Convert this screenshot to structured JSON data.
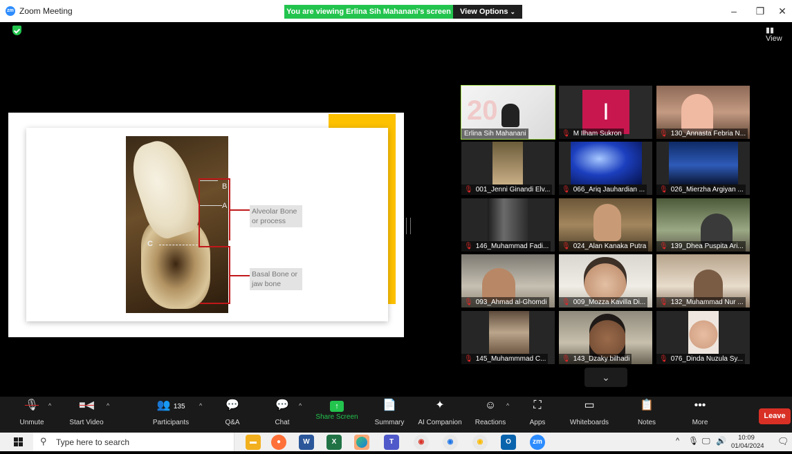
{
  "window": {
    "app_title": "Zoom Meeting",
    "logo_text": "zm",
    "viewing_banner": "You are viewing Erlina Sih Mahanani's screen",
    "view_options_label": "View Options",
    "view_button_label": "View",
    "minimize_glyph": "–",
    "restore_glyph": "❐",
    "close_glyph": "✕"
  },
  "slide": {
    "label_b": "B",
    "label_a": "A",
    "label_c": "C",
    "alveolar_label": "Alveolar Bone or process",
    "basal_label": "Basal Bone or jaw bone",
    "brand_color": "#fdc100"
  },
  "gallery": {
    "participants": [
      {
        "name": "Erlina Sih Mahanani",
        "muted": false,
        "active": true
      },
      {
        "name": "M Ilham Sukron",
        "muted": true
      },
      {
        "name": "130_Annasta Febria N...",
        "muted": true
      },
      {
        "name": "001_Jenni Ginandi Elv...",
        "muted": true
      },
      {
        "name": "066_Ariq Jauhardian ...",
        "muted": true
      },
      {
        "name": "026_Mierzha Argiyan ...",
        "muted": true
      },
      {
        "name": "146_Muhammad Fadi...",
        "muted": true
      },
      {
        "name": "024_Alan Kanaka Putra",
        "muted": true
      },
      {
        "name": "139_Dhea Puspita Ari...",
        "muted": true
      },
      {
        "name": "093_Ahmad al-Ghomdi",
        "muted": true
      },
      {
        "name": "009_Mozza Kavilla Di...",
        "muted": true
      },
      {
        "name": "132_Muhammad Nur ...",
        "muted": true
      },
      {
        "name": "145_Muhammmad C...",
        "muted": true
      },
      {
        "name": "143_Dzaky bilhadi",
        "muted": true
      },
      {
        "name": "076_Dinda Nuzula Sy...",
        "muted": true
      }
    ],
    "avatar_letter": "I",
    "avatar_color": "#c8174f",
    "active_color": "#a5e04c"
  },
  "toolbar": {
    "unmute": "Unmute",
    "start_video": "Start Video",
    "participants": "Participants",
    "participants_count": "135",
    "qa": "Q&A",
    "chat": "Chat",
    "share_screen": "Share Screen",
    "summary": "Summary",
    "ai_companion": "AI Companion",
    "reactions": "Reactions",
    "apps": "Apps",
    "whiteboards": "Whiteboards",
    "notes": "Notes",
    "more": "More",
    "leave": "Leave",
    "share_color": "#23c44e",
    "leave_color": "#d93025"
  },
  "taskbar": {
    "search_placeholder": "Type here to search",
    "time": "10:09",
    "date": "01/04/2024"
  }
}
